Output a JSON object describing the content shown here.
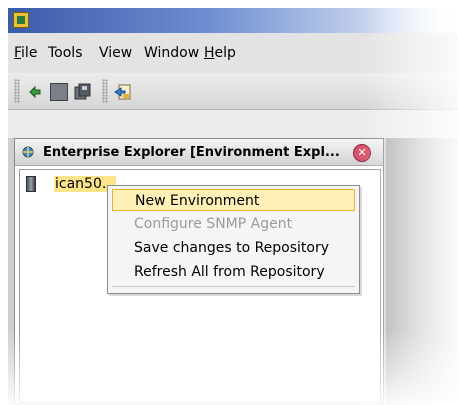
{
  "menubar": {
    "items": [
      {
        "label": "File",
        "mnemonic": "F",
        "rest": "ile"
      },
      {
        "label": "Tools"
      },
      {
        "label": "View"
      },
      {
        "label": "Window"
      },
      {
        "label": "Help",
        "mnemonic": "H",
        "rest": "elp"
      }
    ]
  },
  "toolbar": {
    "icons": [
      "refresh-icon",
      "save-icon",
      "save-all-icon",
      "import-icon"
    ]
  },
  "explorer": {
    "title": "Enterprise Explorer [Environment Expl...",
    "node_label": "ican50..."
  },
  "context_menu": {
    "items": [
      {
        "label": "New Environment",
        "state": "highlighted"
      },
      {
        "label": "Configure SNMP Agent",
        "state": "disabled"
      },
      {
        "label": "Save changes to Repository",
        "state": "enabled"
      },
      {
        "label": "Refresh All from Repository",
        "state": "enabled"
      }
    ]
  },
  "colors": {
    "highlight_bg": "#fff0b8",
    "highlight_border": "#e6b441",
    "close_button": "#d9536b",
    "titlebar_start": "#3b5aa8"
  }
}
